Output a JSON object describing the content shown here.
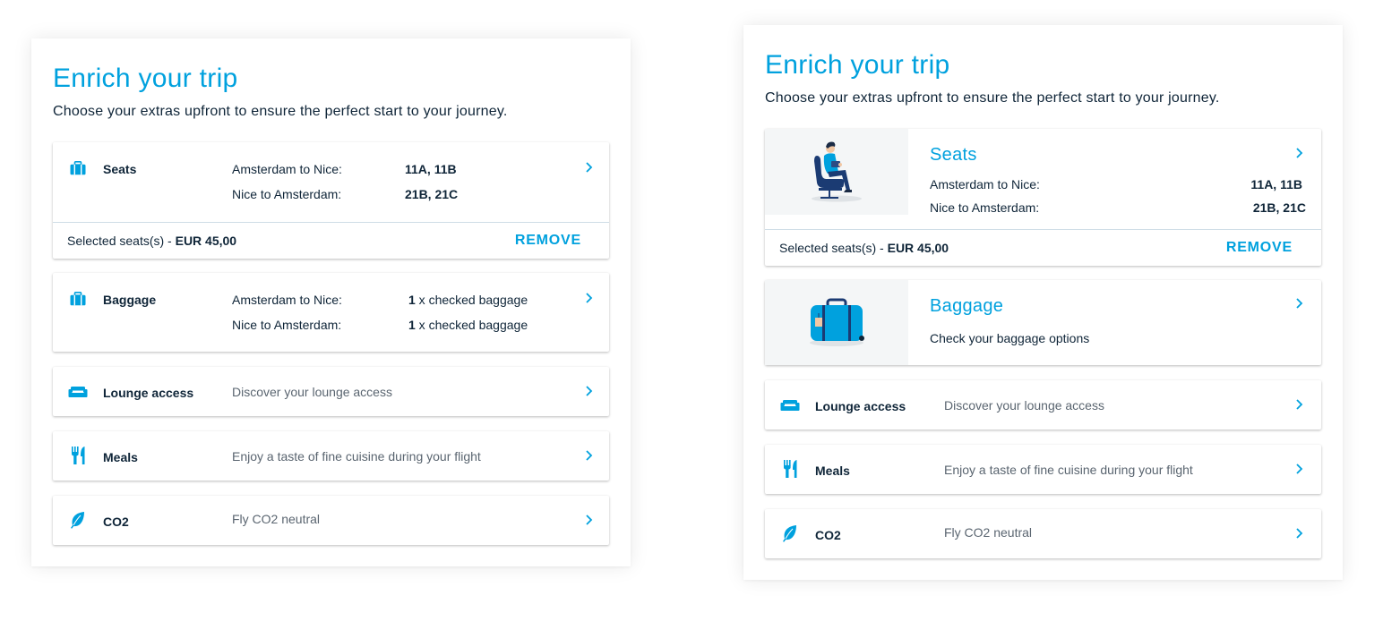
{
  "colors": {
    "accent": "#00a1de",
    "text": "#0f2538",
    "muted": "#5a6570"
  },
  "panel_a": {
    "title": "Enrich your trip",
    "subtitle": "Choose your extras upfront to ensure the perfect start to your journey.",
    "seats": {
      "icon": "suitcase-icon",
      "title": "Seats",
      "rows": [
        {
          "route": "Amsterdam to Nice:",
          "value": "11A, 11B"
        },
        {
          "route": "Nice to Amsterdam:",
          "value": "21B, 21C"
        }
      ],
      "footer_label": "Selected seats(s) - ",
      "footer_price": "EUR 45,00",
      "remove": "REMOVE"
    },
    "baggage": {
      "icon": "suitcase-icon",
      "title": "Baggage",
      "rows": [
        {
          "route": "Amsterdam to Nice:",
          "count": "1",
          "value": " x checked baggage"
        },
        {
          "route": "Nice to Amsterdam:",
          "count": "1",
          "value": " x checked baggage"
        }
      ]
    },
    "lounge": {
      "icon": "sofa-icon",
      "title": "Lounge access",
      "desc": "Discover your lounge access"
    },
    "meals": {
      "icon": "cutlery-icon",
      "title": "Meals",
      "desc": "Enjoy a taste of fine cuisine during your flight"
    },
    "co2": {
      "icon": "leaf-icon",
      "title": "CO2",
      "desc": "Fly CO2 neutral"
    }
  },
  "panel_b": {
    "title": "Enrich your trip",
    "subtitle": "Choose your extras upfront to ensure the perfect start to your journey.",
    "seats": {
      "illustration": "seated-passenger-illustration",
      "title": "Seats",
      "rows": [
        {
          "route": "Amsterdam to Nice:",
          "value": "11A, 11B"
        },
        {
          "route": "Nice to Amsterdam:",
          "value": "21B, 21C"
        }
      ],
      "footer_label": "Selected seats(s) - ",
      "footer_price": "EUR 45,00",
      "remove": "REMOVE"
    },
    "baggage": {
      "illustration": "suitcase-illustration",
      "title": "Baggage",
      "desc": "Check your baggage options"
    },
    "lounge": {
      "icon": "sofa-icon",
      "title": "Lounge access",
      "desc": "Discover your lounge access"
    },
    "meals": {
      "icon": "cutlery-icon",
      "title": "Meals",
      "desc": "Enjoy a taste of fine cuisine during your flight"
    },
    "co2": {
      "icon": "leaf-icon",
      "title": "CO2",
      "desc": "Fly CO2 neutral"
    }
  }
}
